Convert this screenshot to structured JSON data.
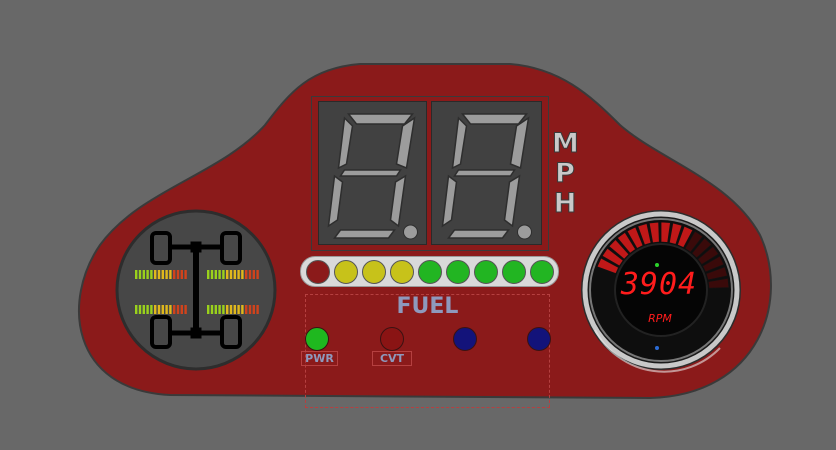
{
  "speedometer": {
    "digits": [
      "8.",
      "8."
    ],
    "unit_letters": [
      "M",
      "P",
      "H"
    ]
  },
  "fuel": {
    "label": "FUEL",
    "gauge_leds": [
      {
        "color": "#8b1a1a",
        "state": "off"
      },
      {
        "color": "#c7c21a",
        "state": "on"
      },
      {
        "color": "#c7c21a",
        "state": "on"
      },
      {
        "color": "#c7c21a",
        "state": "on"
      },
      {
        "color": "#22b522",
        "state": "on"
      },
      {
        "color": "#22b522",
        "state": "on"
      },
      {
        "color": "#22b522",
        "state": "on"
      },
      {
        "color": "#22b522",
        "state": "on"
      },
      {
        "color": "#22b522",
        "state": "on"
      }
    ]
  },
  "indicators": [
    {
      "label": "PWR",
      "color": "#1fb81f"
    },
    {
      "label": "CVT",
      "color": "#8a1414"
    },
    {
      "label": "",
      "color": "#13137a"
    },
    {
      "label": "",
      "color": "#13137a"
    }
  ],
  "tachometer": {
    "value": "3904",
    "unit": "RPM",
    "level": 0.6
  },
  "drivetrain": {
    "icon": "4wd-axle-icon",
    "wheel_level_bars": 4
  },
  "colors": {
    "panel_red": "#8b1a1a",
    "background": "#686868",
    "display_red": "#ff1c1c",
    "segment_gray": "#9c9c9c"
  }
}
